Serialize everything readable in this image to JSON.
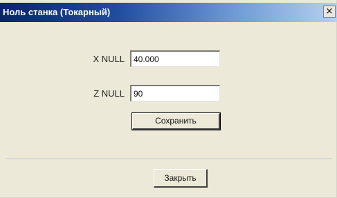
{
  "window": {
    "title": "Ноль станка (Токарный)",
    "close_glyph": "×"
  },
  "form": {
    "x_label": "X NULL",
    "x_value": "40.000",
    "z_label": "Z NULL",
    "z_value": "90",
    "save_label": "Сохранить"
  },
  "footer": {
    "close_label": "Закрыть"
  }
}
